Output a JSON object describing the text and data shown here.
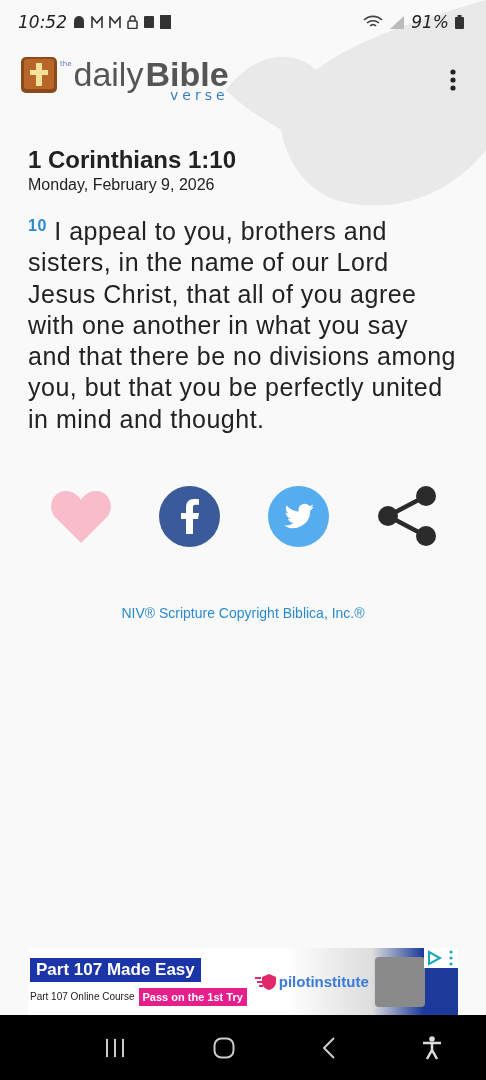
{
  "status_bar": {
    "time": "10:52",
    "battery": "91%"
  },
  "header": {
    "logo": {
      "the": "the",
      "daily": "daily",
      "bible": "Bible",
      "verse": "verse"
    }
  },
  "reference": "1 Corinthians 1:10",
  "date": "Monday, February 9, 2026",
  "verse": "$^{10}$ I appeal to you, brothers and sisters, in the name of our Lord Jesus Christ, that all of you agree with one another in what you say and that there be no divisions among you, but that you be perfectly united in mind and thought.",
  "actions": [
    {
      "kind": "like"
    },
    {
      "kind": "facebook"
    },
    {
      "kind": "twitter"
    },
    {
      "kind": "share"
    }
  ],
  "copyright": "NIV® Scripture Copyright Biblica, Inc.®",
  "ad": {
    "headline": "Part 107 Made Easy",
    "subline": "Part 107 Online Course",
    "badge": "Pass on the 1st Try",
    "brand": "pilotinstitute"
  }
}
